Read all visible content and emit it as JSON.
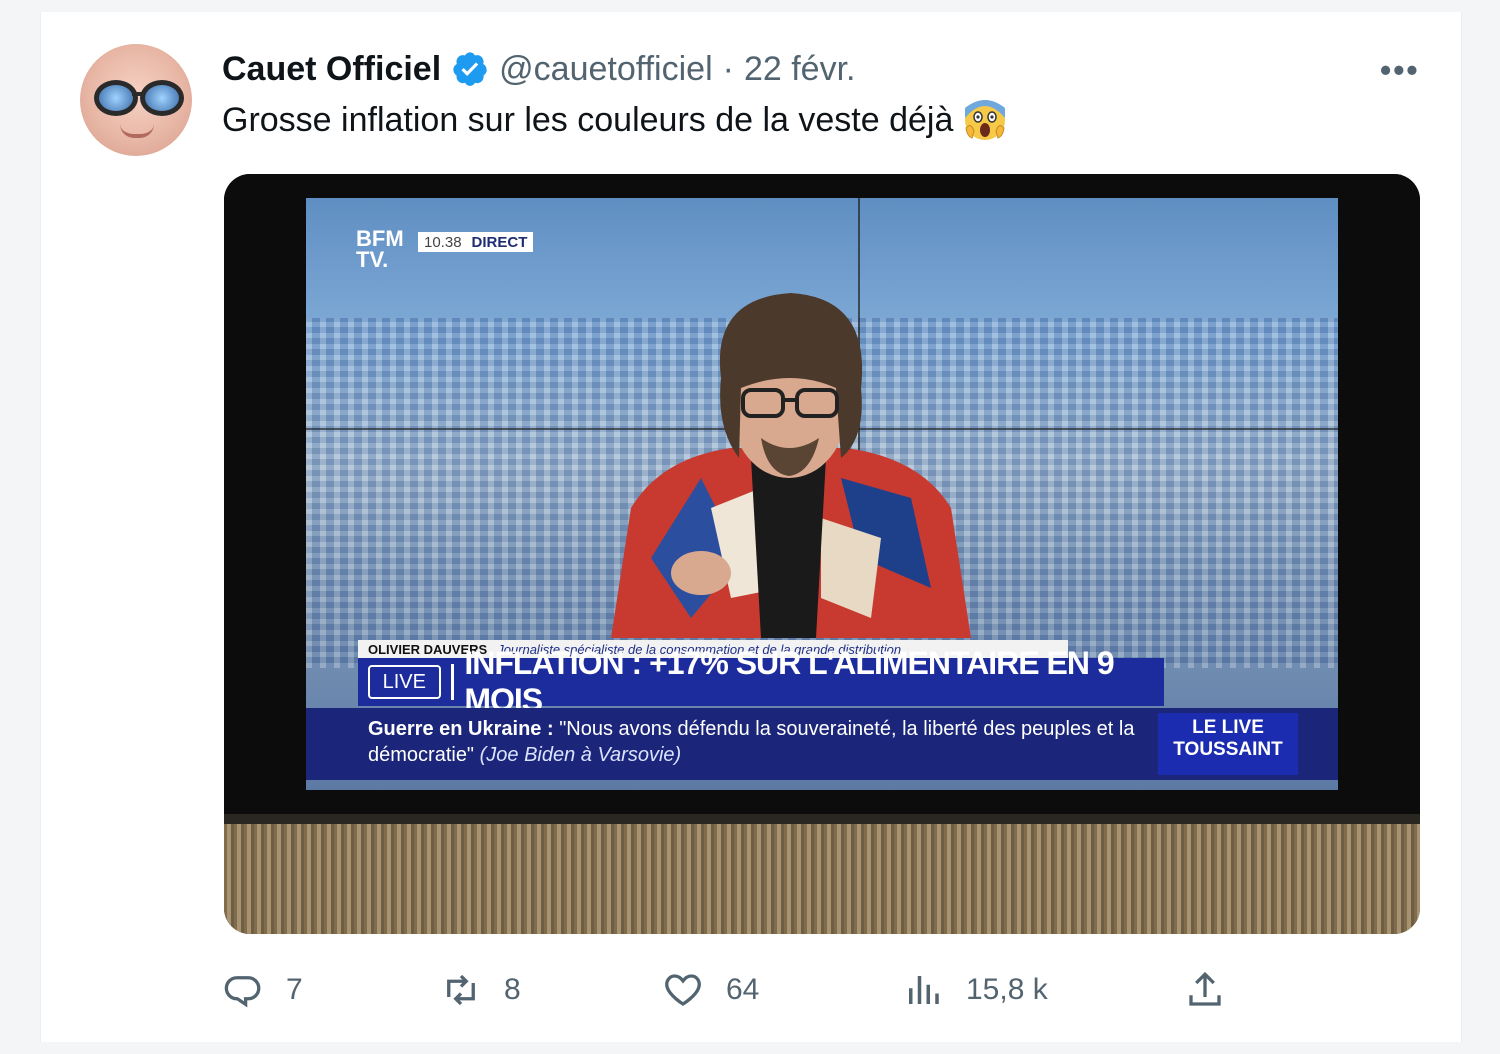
{
  "tweet": {
    "author_name": "Cauet Officiel",
    "handle": "@cauetofficiel",
    "separator": "·",
    "date": "22 févr.",
    "more_label": "•••",
    "text": "Grosse inflation sur les couleurs de la veste déjà",
    "emoji": "face-screaming-in-fear"
  },
  "media": {
    "channel_logo": "BFM TV.",
    "time": "10.38",
    "direct_label": "DIRECT",
    "guest_name": "OLIVIER DAUVERS",
    "guest_role": "Journaliste spécialiste de la consommation et de la grande distribution",
    "live_badge": "LIVE",
    "headline": "INFLATION : +17% SUR L'ALIMENTAIRE EN 9 MOIS",
    "ticker_topic": "Guerre en Ukraine :",
    "ticker_quote": "\"Nous avons défendu la souveraineté, la liberté des peuples et la démocratie\"",
    "ticker_source": "(Joe Biden à Varsovie)",
    "show_name": "LE LIVE TOUSSAINT"
  },
  "actions": {
    "replies": "7",
    "retweets": "8",
    "likes": "64",
    "views": "15,8 k"
  },
  "colors": {
    "verified": "#1d9bf0",
    "muted_text": "#536471",
    "headline_band": "#1d2c9d"
  }
}
